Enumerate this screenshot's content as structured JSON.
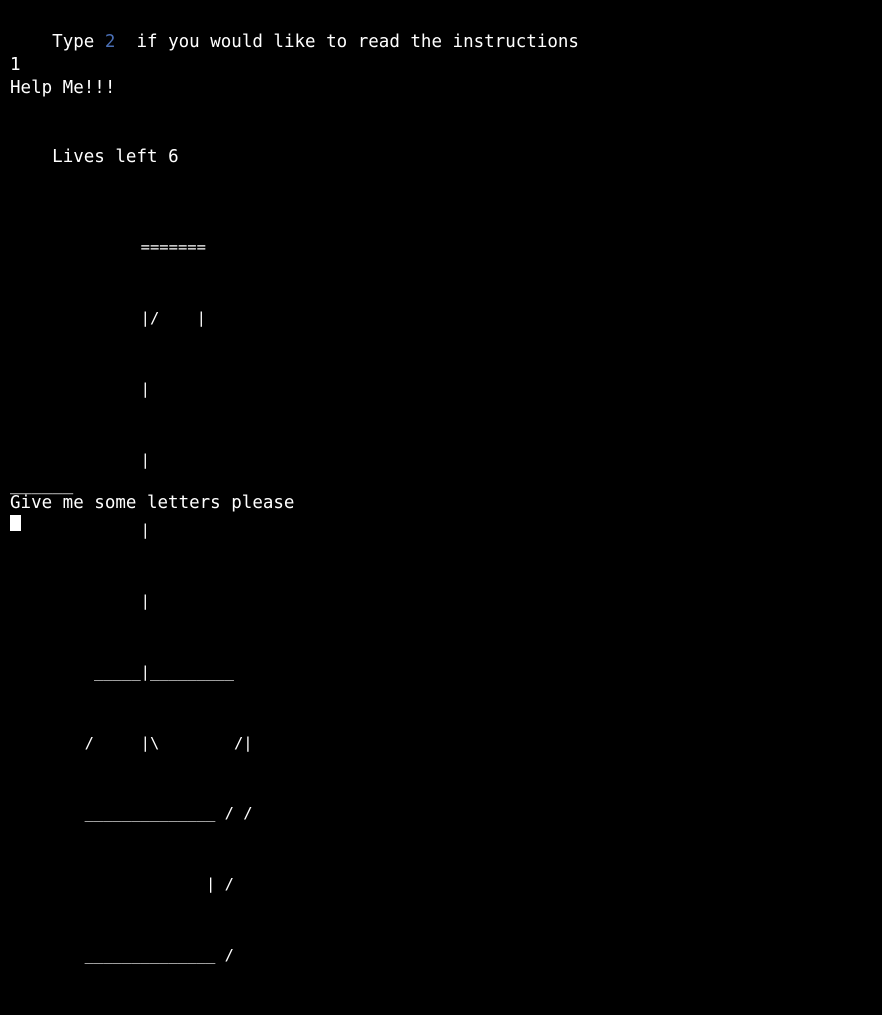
{
  "colors": {
    "background": "#000000",
    "text": "#ffffff",
    "accent": "#4a6fb5"
  },
  "prompt": {
    "before": "Type ",
    "number": "2",
    "after": "  if you would like to read the instructions"
  },
  "input_echo": "1",
  "help_line": "Help Me!!!",
  "lives": {
    "label": "Lives left ",
    "count": "6"
  },
  "hangman_art": [
    "              =======",
    "              |/    |",
    "              |",
    "              |",
    "              |",
    "              |",
    "         _____|_________",
    "        /     |\\        /|",
    "        ______________ / /",
    "                     | /",
    "        ______________ /"
  ],
  "word_blanks": "______",
  "request_line": "Give me some letters please"
}
